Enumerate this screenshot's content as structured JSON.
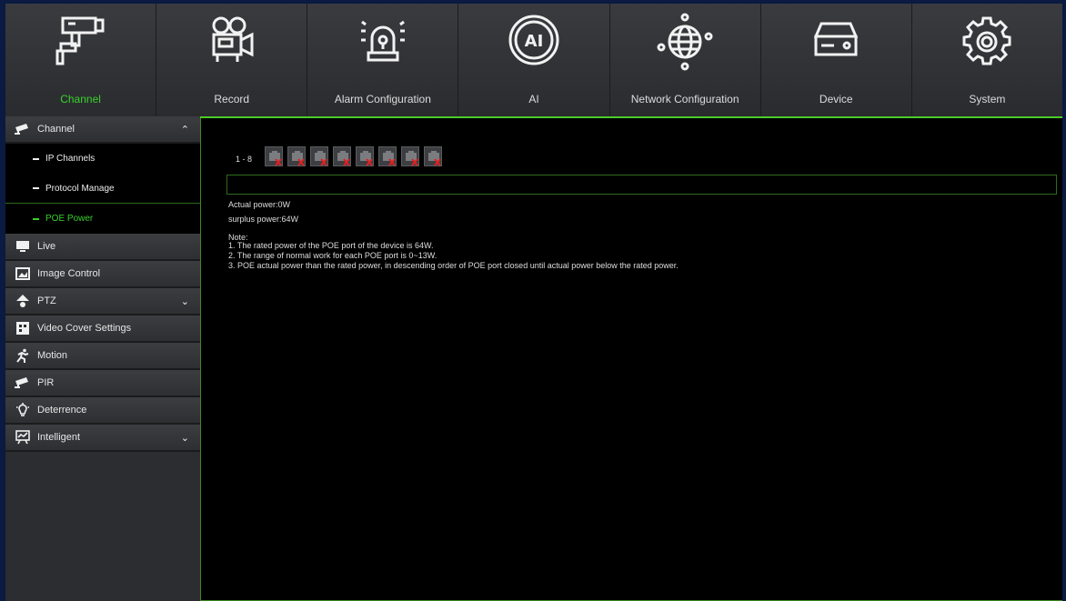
{
  "nav": {
    "tabs": [
      {
        "label": "Channel",
        "icon": "camera-icon",
        "active": true
      },
      {
        "label": "Record",
        "icon": "film-camera-icon",
        "active": false
      },
      {
        "label": "Alarm Configuration",
        "icon": "alarm-light-icon",
        "active": false
      },
      {
        "label": "AI",
        "icon": "ai-head-icon",
        "active": false
      },
      {
        "label": "Network Configuration",
        "icon": "globe-network-icon",
        "active": false
      },
      {
        "label": "Device",
        "icon": "hdd-device-icon",
        "active": false
      },
      {
        "label": "System",
        "icon": "gear-icon",
        "active": false
      }
    ]
  },
  "sidebar": {
    "channel": {
      "label": "Channel",
      "icon": "camera-icon",
      "chevron": "up"
    },
    "subitems": [
      {
        "label": "IP Channels",
        "active": false
      },
      {
        "label": "Protocol Manage",
        "active": false
      },
      {
        "label": "POE Power",
        "active": true
      }
    ],
    "items": [
      {
        "label": "Live",
        "icon": "monitor-icon"
      },
      {
        "label": "Image Control",
        "icon": "image-icon"
      },
      {
        "label": "PTZ",
        "icon": "ptz-dome-icon",
        "chevron": "down"
      },
      {
        "label": "Video Cover Settings",
        "icon": "grid-cover-icon"
      },
      {
        "label": "Motion",
        "icon": "running-man-icon"
      },
      {
        "label": "PIR",
        "icon": "camera-icon"
      },
      {
        "label": "Deterrence",
        "icon": "light-bulb-icon"
      },
      {
        "label": "Intelligent",
        "icon": "easel-icon",
        "chevron": "down"
      }
    ]
  },
  "main": {
    "range": "1 - 8",
    "ports": [
      {
        "status": "disconnected"
      },
      {
        "status": "disconnected"
      },
      {
        "status": "disconnected"
      },
      {
        "status": "disconnected"
      },
      {
        "status": "disconnected"
      },
      {
        "status": "disconnected"
      },
      {
        "status": "disconnected"
      },
      {
        "status": "disconnected"
      }
    ],
    "actual_power": "Actual power:0W",
    "surplus_power": "surplus power:64W",
    "note_title": "Note:",
    "notes": [
      "1. The rated power of the POE port of the device is 64W.",
      "2. The range of normal work for each POE port is 0~13W.",
      "3. POE actual power than the rated power, in descending order of POE port closed until actual power below the rated power."
    ]
  },
  "colors": {
    "accent": "#37d12c",
    "background": "#000000",
    "sidebar": "#2c2d30"
  }
}
